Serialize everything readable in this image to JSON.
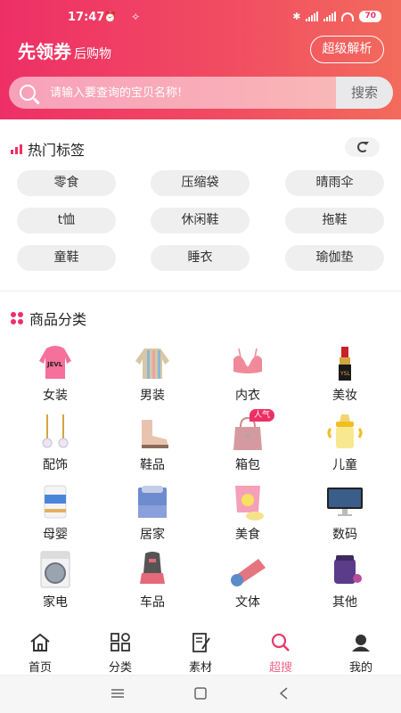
{
  "status_bar": {
    "time": "17:47",
    "battery": "70"
  },
  "header": {
    "brand_main": "先领券",
    "brand_sub": "后购物",
    "analyze_button": "超级解析"
  },
  "search": {
    "placeholder": "请输入要查询的宝贝名称!",
    "button": "搜索"
  },
  "hot_tags": {
    "title": "热门标签",
    "items": [
      "零食",
      "压缩袋",
      "晴雨伞",
      "t恤",
      "休闲鞋",
      "拖鞋",
      "童鞋",
      "睡衣",
      "瑜伽垫"
    ]
  },
  "categories": {
    "title": "商品分类",
    "items": [
      {
        "label": "女装",
        "icon": "pink-hoodie-icon"
      },
      {
        "label": "男装",
        "icon": "striped-sweater-icon"
      },
      {
        "label": "内衣",
        "icon": "bra-icon"
      },
      {
        "label": "美妆",
        "icon": "lipstick-icon"
      },
      {
        "label": "配饰",
        "icon": "pearl-earrings-icon"
      },
      {
        "label": "鞋品",
        "icon": "boots-icon"
      },
      {
        "label": "箱包",
        "icon": "handbag-icon"
      },
      {
        "label": "儿童",
        "icon": "baby-bottle-icon"
      },
      {
        "label": "母婴",
        "icon": "formula-can-icon"
      },
      {
        "label": "居家",
        "icon": "bedding-icon"
      },
      {
        "label": "美食",
        "icon": "snacks-icon"
      },
      {
        "label": "数码",
        "icon": "monitor-icon"
      },
      {
        "label": "家电",
        "icon": "washing-machine-icon"
      },
      {
        "label": "车品",
        "icon": "car-seat-icon"
      },
      {
        "label": "文体",
        "icon": "yoga-mat-icon"
      },
      {
        "label": "其他",
        "icon": "supplement-icon"
      }
    ],
    "badge": "人气"
  },
  "bottom_nav": [
    {
      "label": "首页",
      "icon": "home-icon"
    },
    {
      "label": "分类",
      "icon": "grid-icon"
    },
    {
      "label": "素材",
      "icon": "edit-doc-icon"
    },
    {
      "label": "超搜",
      "icon": "search-icon"
    },
    {
      "label": "我的",
      "icon": "user-icon"
    }
  ],
  "colors": {
    "accent": "#ee2f66",
    "active_nav": "#f06a8a",
    "tag_bg": "#efefef"
  }
}
